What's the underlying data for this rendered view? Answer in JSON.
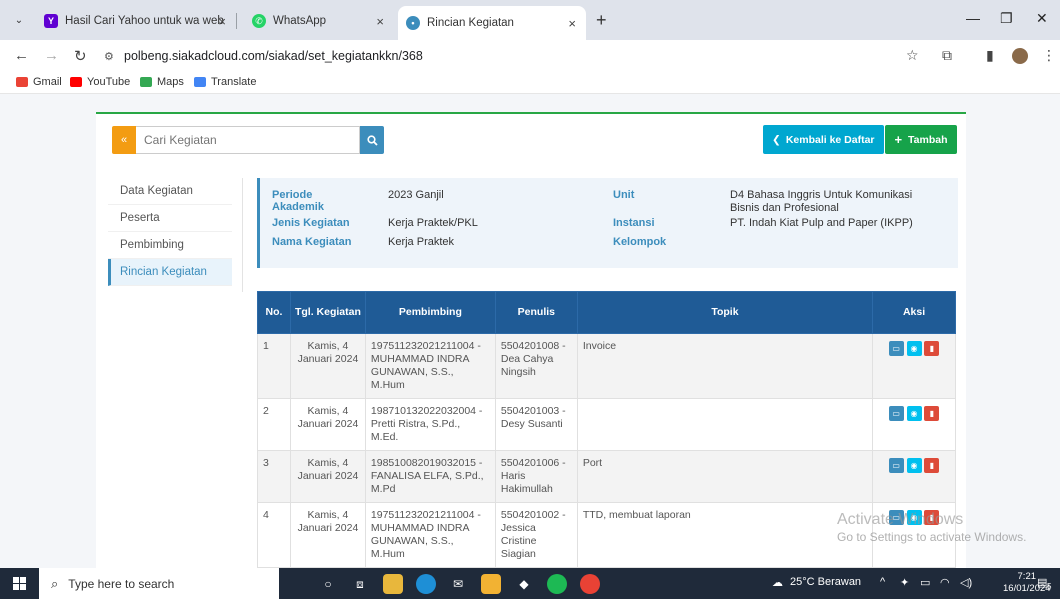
{
  "browser": {
    "tabs": [
      {
        "title": "Hasil Cari Yahoo untuk wa web",
        "active": false
      },
      {
        "title": "WhatsApp",
        "active": false
      },
      {
        "title": "Rincian Kegiatan",
        "active": true
      }
    ],
    "url": "polbeng.siakadcloud.com/siakad/set_kegiatankkn/368",
    "bookmarks": [
      "Gmail",
      "YouTube",
      "Maps",
      "Translate"
    ]
  },
  "page": {
    "search_placeholder": "Cari Kegiatan",
    "back_button": "Kembali ke Daftar",
    "add_button": "Tambah",
    "sidemenu": [
      {
        "label": "Data Kegiatan",
        "active": false
      },
      {
        "label": "Peserta",
        "active": false
      },
      {
        "label": "Pembimbing",
        "active": false
      },
      {
        "label": "Rincian Kegiatan",
        "active": true
      }
    ],
    "info": {
      "periode_label": "Periode Akademik",
      "periode_value": "2023 Ganjil",
      "jenis_label": "Jenis Kegiatan",
      "jenis_value": "Kerja Praktek/PKL",
      "nama_label": "Nama Kegiatan",
      "nama_value": "Kerja Praktek",
      "unit_label": "Unit",
      "unit_value": "D4 Bahasa Inggris Untuk Komunikasi Bisnis dan Profesional",
      "instansi_label": "Instansi",
      "instansi_value": "PT. Indah Kiat Pulp and Paper (IKPP)",
      "kelompok_label": "Kelompok",
      "kelompok_value": ""
    },
    "table": {
      "headers": {
        "no": "No.",
        "tgl": "Tgl. Kegiatan",
        "pembimbing": "Pembimbing",
        "penulis": "Penulis",
        "topik": "Topik",
        "aksi": "Aksi"
      },
      "rows": [
        {
          "no": "1",
          "tgl": "Kamis, 4 Januari 2024",
          "pembimbing": "197511232021211004 - MUHAMMAD INDRA GUNAWAN, S.S., M.Hum",
          "penulis": "5504201008 - Dea Cahya Ningsih",
          "topik": "Invoice"
        },
        {
          "no": "2",
          "tgl": "Kamis, 4 Januari 2024",
          "pembimbing": "198710132022032004 - Pretti Ristra, S.Pd., M.Ed.",
          "penulis": "5504201003 - Desy Susanti",
          "topik": ""
        },
        {
          "no": "3",
          "tgl": "Kamis, 4 Januari 2024",
          "pembimbing": "198510082019032015 - FANALISA ELFA, S.Pd., M.Pd",
          "penulis": "5504201006 - Haris Hakimullah",
          "topik": "Port"
        },
        {
          "no": "4",
          "tgl": "Kamis, 4 Januari 2024",
          "pembimbing": "197511232021211004 - MUHAMMAD INDRA GUNAWAN, S.S., M.Hum",
          "penulis": "5504201002 - Jessica Cristine Siagian",
          "topik": "TTD, membuat laporan"
        }
      ]
    }
  },
  "watermark": {
    "line1": "Activate Windows",
    "line2": "Go to Settings to activate Windows."
  },
  "taskbar": {
    "search_placeholder": "Type here to search",
    "weather": "25°C Berawan",
    "time": "7:21",
    "date": "16/01/2024",
    "notif_count": "5"
  }
}
